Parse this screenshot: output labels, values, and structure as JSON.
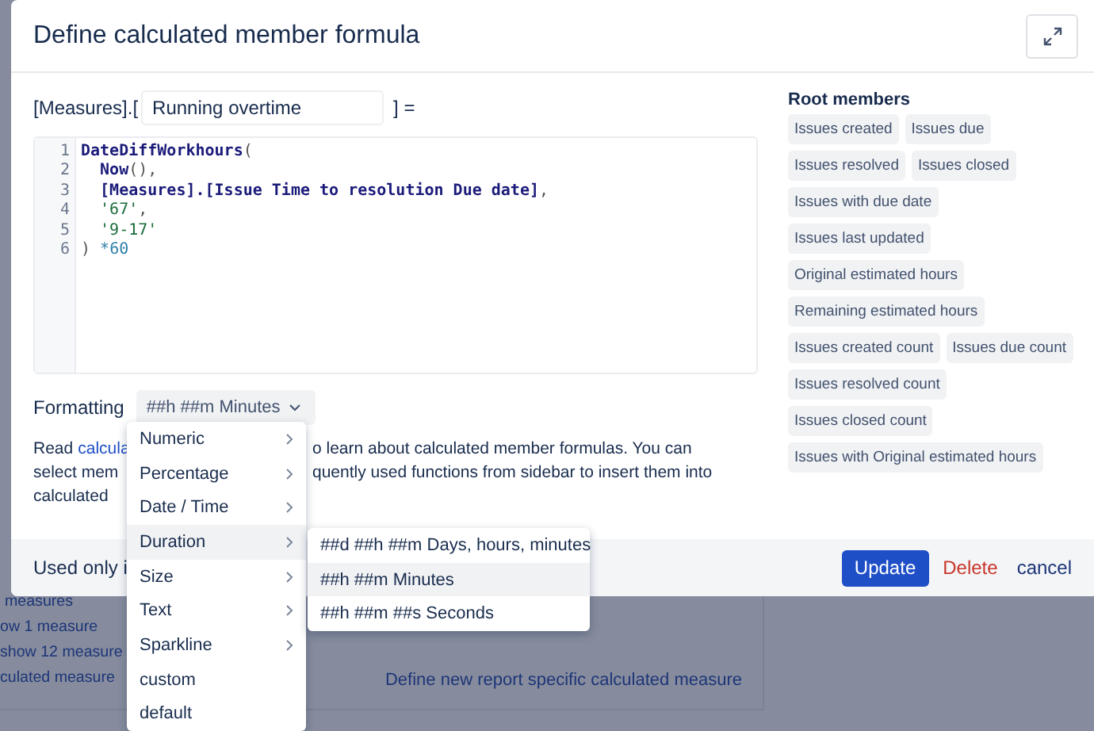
{
  "background": {
    "list_items": [
      "measures",
      "ow 1 measure",
      "show 12 measure",
      "culated measure"
    ],
    "define_link": "Define new report specific calculated measure"
  },
  "dialog": {
    "title": "Define calculated member formula",
    "name_prefix": "[Measures].[",
    "name_value": "Running overtime",
    "name_suffix": "] =",
    "code_lines": [
      {
        "number": "1",
        "tokens": [
          {
            "kind": "fn",
            "text": "DateDiffWorkhours"
          },
          {
            "kind": "punct",
            "text": "("
          }
        ]
      },
      {
        "number": "2",
        "tokens": [
          {
            "kind": "fn",
            "text": "  Now"
          },
          {
            "kind": "punct",
            "text": "(),"
          }
        ]
      },
      {
        "number": "3",
        "tokens": [
          {
            "kind": "member",
            "text": "  [Measures].[Issue Time to resolution Due date]"
          },
          {
            "kind": "punct",
            "text": ","
          }
        ]
      },
      {
        "number": "4",
        "tokens": [
          {
            "kind": "str",
            "text": "  '67'"
          },
          {
            "kind": "punct",
            "text": ","
          }
        ]
      },
      {
        "number": "5",
        "tokens": [
          {
            "kind": "str",
            "text": "  '9-17'"
          }
        ]
      },
      {
        "number": "6",
        "tokens": [
          {
            "kind": "punct",
            "text": ")"
          },
          {
            "kind": "num",
            "text": " *60"
          }
        ]
      }
    ],
    "formatting_label": "Formatting",
    "formatting_value": "##h ##m Minutes",
    "help_left": [
      {
        "text": "Read",
        "link": "calcula"
      },
      {
        "text": "select mem"
      },
      {
        "text": "calculated"
      }
    ],
    "help_right": [
      "o learn about calculated member formulas. You can",
      "quently used functions from sidebar to insert them into"
    ],
    "footer_note": "Used only i",
    "buttons": {
      "update": "Update",
      "delete": "Delete",
      "cancel": "cancel"
    },
    "root_members_title": "Root members",
    "root_members": [
      "Issues created",
      "Issues due",
      "Issues resolved",
      "Issues closed",
      "Issues with due date",
      "Issues last updated",
      "Original estimated hours",
      "Remaining estimated hours",
      "Issues created count",
      "Issues due count",
      "Issues resolved count",
      "Issues closed count",
      "Issues with Original estimated hours"
    ]
  },
  "format_menu": [
    {
      "label": "Numeric",
      "kind": "submenu",
      "selected": false
    },
    {
      "label": "Percentage",
      "kind": "submenu",
      "selected": false
    },
    {
      "label": "Date / Time",
      "kind": "submenu",
      "selected": false
    },
    {
      "label": "Duration",
      "kind": "submenu",
      "selected": true
    },
    {
      "label": "Size",
      "kind": "submenu",
      "selected": false
    },
    {
      "label": "Text",
      "kind": "submenu",
      "selected": false
    },
    {
      "label": "Sparkline",
      "kind": "submenu",
      "selected": false
    },
    {
      "label": "custom",
      "kind": "item",
      "selected": false
    },
    {
      "label": "default",
      "kind": "item",
      "selected": false
    }
  ],
  "duration_menu": [
    {
      "label": "##d ##h ##m Days, hours, minutes",
      "selected": false
    },
    {
      "label": "##h ##m Minutes",
      "selected": true
    },
    {
      "label": "##h ##m ##s Seconds",
      "selected": false
    }
  ]
}
